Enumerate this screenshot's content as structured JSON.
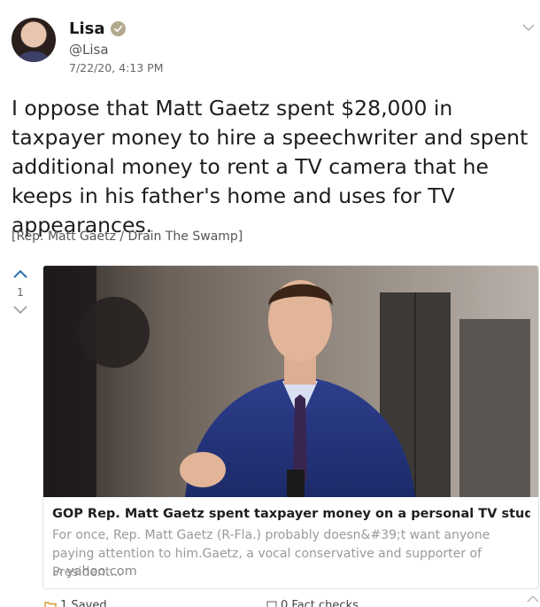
{
  "author": {
    "display_name": "Lisa",
    "handle": "@Lisa",
    "timestamp": "7/22/20, 4:13 PM",
    "verified_icon": "verified-check-icon"
  },
  "post": {
    "text": "I oppose that Matt Gaetz spent $28,000 in taxpayer money to hire a speechwriter and spent additional money to rent a TV camera that he keeps in his father's home and uses for TV appearances.",
    "source_tag": "[Rep. Matt Gaetz / Drain The Swamp]"
  },
  "votes": {
    "count": "1"
  },
  "link_card": {
    "title": "GOP Rep. Matt Gaetz spent taxpayer money on a personal TV studio",
    "description": "For once, Rep. Matt Gaetz (R-Fla.) probably doesn&#39;t want anyone paying attention to him.Gaetz, a vocal conservative and supporter of President...",
    "domain": "yahoo.com"
  },
  "footer": {
    "saved_label": "1 Saved",
    "fact_checks_label": "0 Fact checks"
  },
  "colors": {
    "accent": "#2a8ad0",
    "verified": "#b3a98d",
    "muted_text": "#9a9a9a"
  }
}
